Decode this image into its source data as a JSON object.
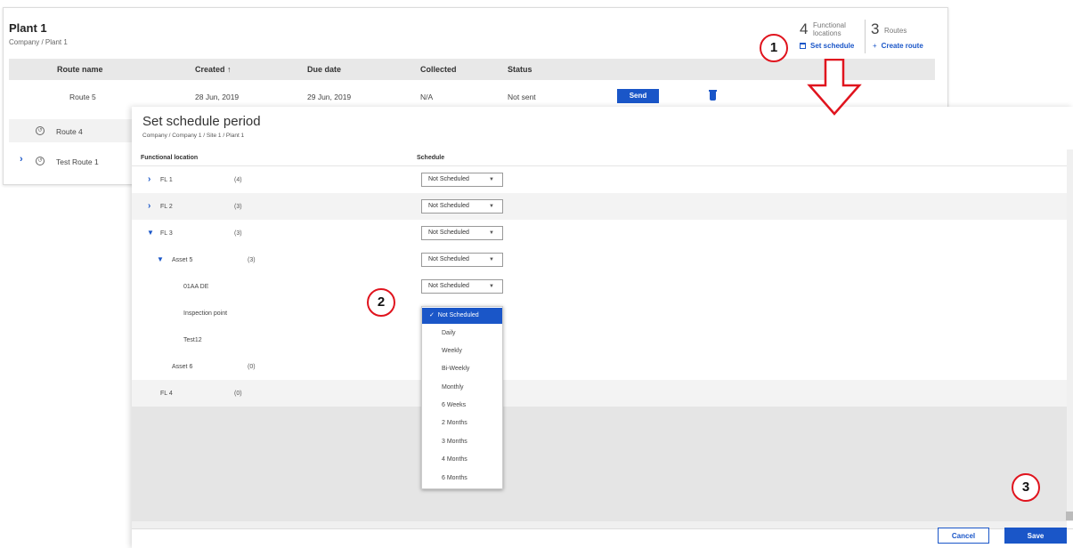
{
  "plant": {
    "title": "Plant 1",
    "breadcrumb": "Company / Plant 1",
    "stats": {
      "functional_count": "4",
      "functional_label_line1": "Functional",
      "functional_label_line2": "locations",
      "routes_count": "3",
      "routes_label": "Routes"
    },
    "set_schedule_label": "Set schedule",
    "create_route_icon": "+",
    "create_route_label": "Create route"
  },
  "routes_table": {
    "headers": {
      "route_name": "Route name",
      "created": "Created",
      "created_sort_icon": "↑",
      "due_date": "Due date",
      "collected": "Collected",
      "status": "Status"
    },
    "rows": [
      {
        "name": "Route 5",
        "created": "28 Jun, 2019",
        "due": "29 Jun, 2019",
        "collected": "N/A",
        "status": "Not sent",
        "action": "Send"
      },
      {
        "name": "Route 4"
      },
      {
        "name": "Test Route 1"
      }
    ]
  },
  "modal": {
    "title": "Set schedule period",
    "breadcrumb": "Company / Company 1 / Site 1 / Plant 1",
    "headers": {
      "functional_location": "Functional location",
      "schedule": "Schedule"
    },
    "rows": [
      {
        "name": "FL 1",
        "count": "(4)",
        "schedule": "Not Scheduled"
      },
      {
        "name": "FL 2",
        "count": "(3)",
        "schedule": "Not Scheduled"
      },
      {
        "name": "FL 3",
        "count": "(3)",
        "schedule": "Not Scheduled"
      },
      {
        "name": "Asset 5",
        "count": "(3)",
        "schedule": "Not Scheduled"
      },
      {
        "name": "01AA DE",
        "schedule": "Not Scheduled"
      },
      {
        "name": "Inspection point"
      },
      {
        "name": "Test12"
      },
      {
        "name": "Asset 6",
        "count": "(0)"
      },
      {
        "name": "FL 4",
        "count": "(0)"
      }
    ],
    "dropdown_options": [
      "Not Scheduled",
      "Daily",
      "Weekly",
      "Bi-Weekly",
      "Monthly",
      "6 Weeks",
      "2 Months",
      "3 Months",
      "4 Months",
      "6 Months"
    ],
    "selected_check": "✓",
    "cancel_label": "Cancel",
    "save_label": "Save"
  },
  "annotations": {
    "step1": "1",
    "step2": "2",
    "step3": "3"
  },
  "colors": {
    "accent": "#1a56c8",
    "annotation": "#e0141e"
  }
}
